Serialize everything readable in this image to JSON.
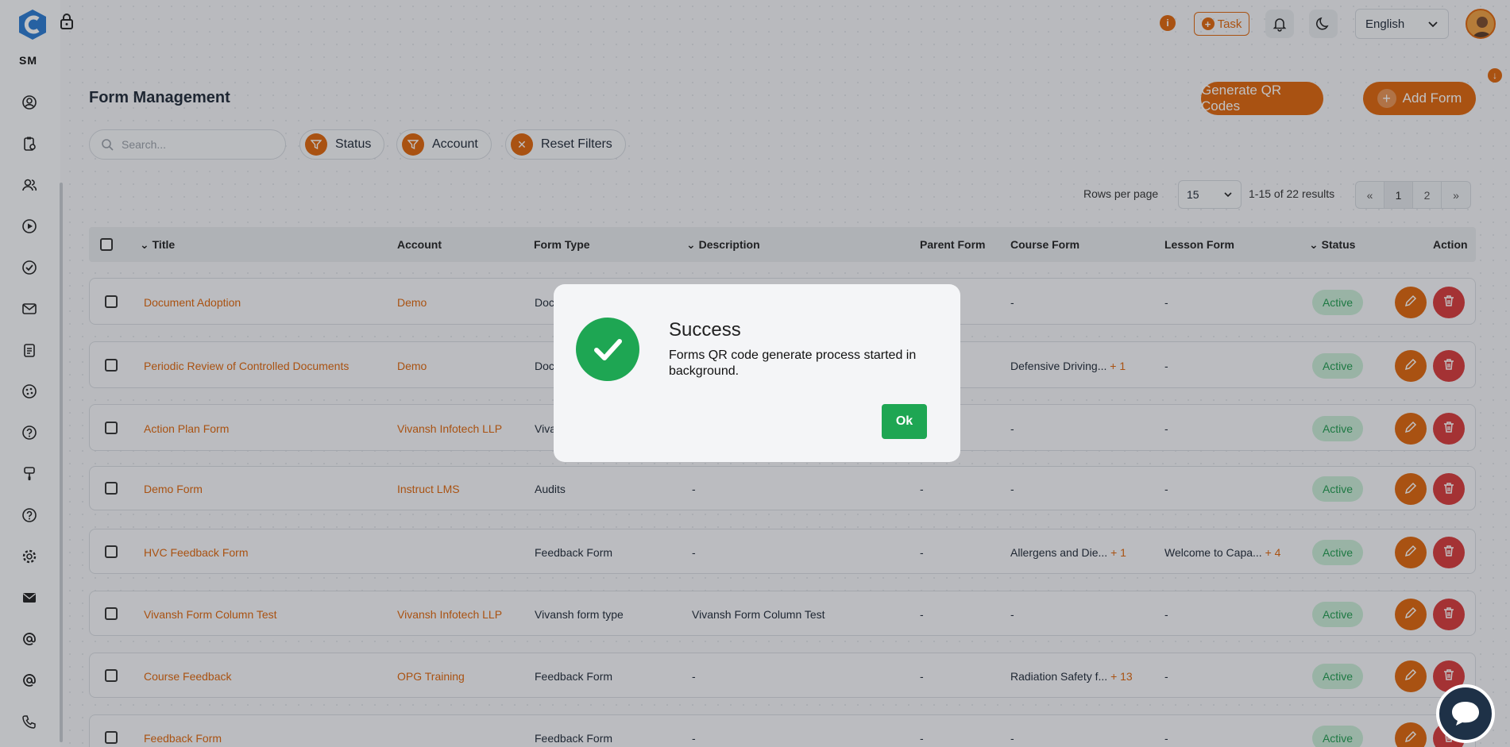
{
  "brand": {
    "initials": "SM"
  },
  "topbar": {
    "task_label": "Task",
    "language": "English"
  },
  "page": {
    "title": "Form Management",
    "generate_qr_label": "Generate QR Codes",
    "add_form_label": "Add Form"
  },
  "filters": {
    "search_placeholder": "Search...",
    "status_label": "Status",
    "account_label": "Account",
    "reset_label": "Reset Filters"
  },
  "pagination": {
    "rows_per_page_label": "Rows per page",
    "rows_per_page_value": "15",
    "results_text": "1-15 of 22 results",
    "pages": [
      "1",
      "2"
    ]
  },
  "table": {
    "columns": {
      "title": "Title",
      "account": "Account",
      "form_type": "Form Type",
      "description": "Description",
      "parent_form": "Parent Form",
      "course_form": "Course Form",
      "lesson_form": "Lesson Form",
      "status": "Status",
      "action": "Action"
    },
    "rows": [
      {
        "title": "Document Adoption",
        "account": "Demo",
        "form_type": "Doc",
        "description": "",
        "parent": "",
        "course": "-",
        "course_more": "",
        "lesson": "-",
        "lesson_more": "",
        "status": "Active"
      },
      {
        "title": "Periodic Review of Controlled Documents",
        "account": "Demo",
        "form_type": "Doc",
        "description": "",
        "parent": "",
        "course": "Defensive Driving...",
        "course_more": "+ 1",
        "lesson": "-",
        "lesson_more": "",
        "status": "Active"
      },
      {
        "title": "Action Plan Form",
        "account": "Vivansh Infotech LLP",
        "form_type": "Viva",
        "description": "",
        "parent": "",
        "course": "-",
        "course_more": "",
        "lesson": "-",
        "lesson_more": "",
        "status": "Active"
      },
      {
        "title": "Demo Form",
        "account": "Instruct LMS",
        "form_type": "Audits",
        "description": "-",
        "parent": "-",
        "course": "-",
        "course_more": "",
        "lesson": "-",
        "lesson_more": "",
        "status": "Active"
      },
      {
        "title": "HVC Feedback Form",
        "account": "",
        "form_type": "Feedback Form",
        "description": "-",
        "parent": "-",
        "course": "Allergens and Die...",
        "course_more": "+ 1",
        "lesson": "Welcome to Capa...",
        "lesson_more": "+ 4",
        "status": "Active"
      },
      {
        "title": "Vivansh Form Column Test",
        "account": "Vivansh Infotech LLP",
        "form_type": "Vivansh form type",
        "description": "Vivansh Form Column Test",
        "parent": "-",
        "course": "-",
        "course_more": "",
        "lesson": "-",
        "lesson_more": "",
        "status": "Active"
      },
      {
        "title": "Course Feedback",
        "account": "OPG Training",
        "form_type": "Feedback Form",
        "description": "-",
        "parent": "-",
        "course": "Radiation Safety f...",
        "course_more": "+ 13",
        "lesson": "-",
        "lesson_more": "",
        "status": "Active"
      },
      {
        "title": "Feedback Form",
        "account": "",
        "form_type": "Feedback Form",
        "description": "-",
        "parent": "-",
        "course": "-",
        "course_more": "",
        "lesson": "-",
        "lesson_more": "",
        "status": "Active"
      }
    ]
  },
  "modal": {
    "title": "Success",
    "message": "Forms QR code generate process started in background.",
    "ok_label": "Ok"
  },
  "colors": {
    "accent": "#e0660b",
    "success": "#1ea653",
    "danger": "#d93a3a",
    "status_bg": "#c9ecd6"
  }
}
